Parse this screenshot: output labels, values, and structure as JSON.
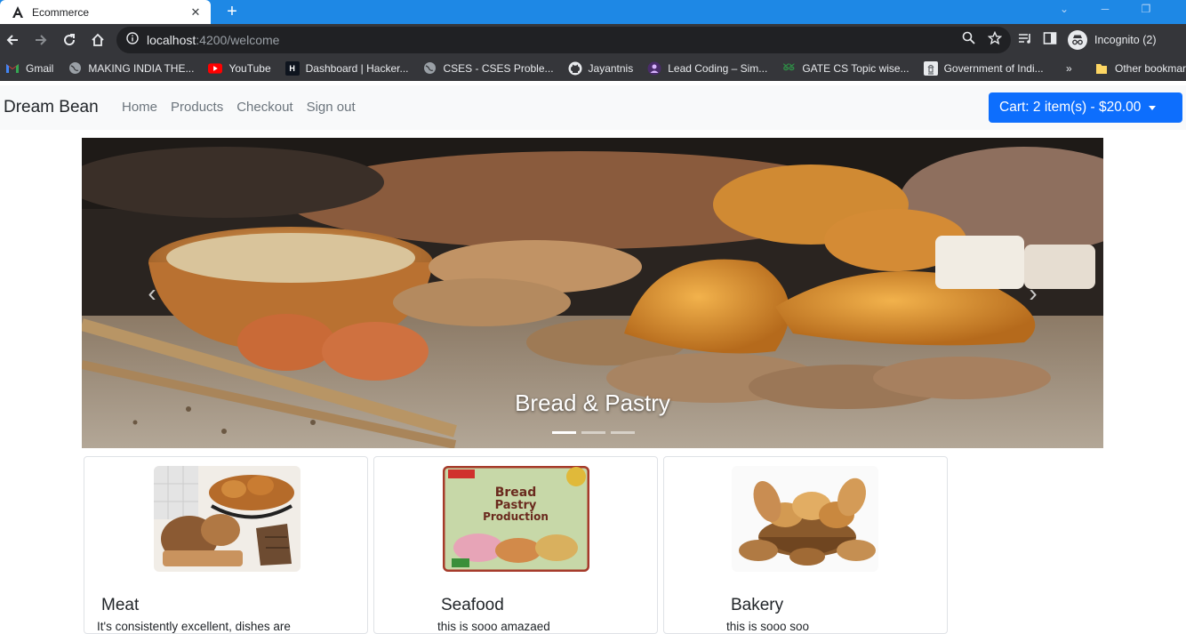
{
  "browser": {
    "tab_title": "Ecommerce",
    "url_host": "localhost",
    "url_path": ":4200/welcome",
    "profile_label": "Incognito (2)",
    "bookmarks": [
      {
        "label": "Gmail",
        "icon": "gmail-icon"
      },
      {
        "label": "MAKING INDIA THE...",
        "icon": "globe-icon"
      },
      {
        "label": "YouTube",
        "icon": "youtube-icon"
      },
      {
        "label": "Dashboard | Hacker...",
        "icon": "hackerrank-icon"
      },
      {
        "label": "CSES - CSES Proble...",
        "icon": "globe-icon"
      },
      {
        "label": "Jayantnis",
        "icon": "github-icon"
      },
      {
        "label": "Lead Coding – Sim...",
        "icon": "leadcoding-icon"
      },
      {
        "label": "GATE CS Topic wise...",
        "icon": "gfg-icon"
      },
      {
        "label": "Government of Indi...",
        "icon": "emblem-icon"
      }
    ],
    "other_bookmarks": "Other bookmarks",
    "overflow": "»"
  },
  "navbar": {
    "brand": "Dream Bean",
    "links": [
      "Home",
      "Products",
      "Checkout",
      "Sign out"
    ],
    "cart_label": "Cart: 2 item(s) - $20.00"
  },
  "carousel": {
    "caption": "Bread & Pastry",
    "active_slide": 1,
    "slide_count": 3
  },
  "cards": [
    {
      "title": "Meat",
      "text": "It's consistently excellent, dishes are"
    },
    {
      "title": "Seafood",
      "text": "this is sooo amazaed"
    },
    {
      "title": "Bakery",
      "text": "this is sooo soo"
    }
  ],
  "colors": {
    "chrome_titlebar": "#1e88e5",
    "cart_button": "#0d6efd",
    "navbar_bg": "#f8f9fa"
  }
}
